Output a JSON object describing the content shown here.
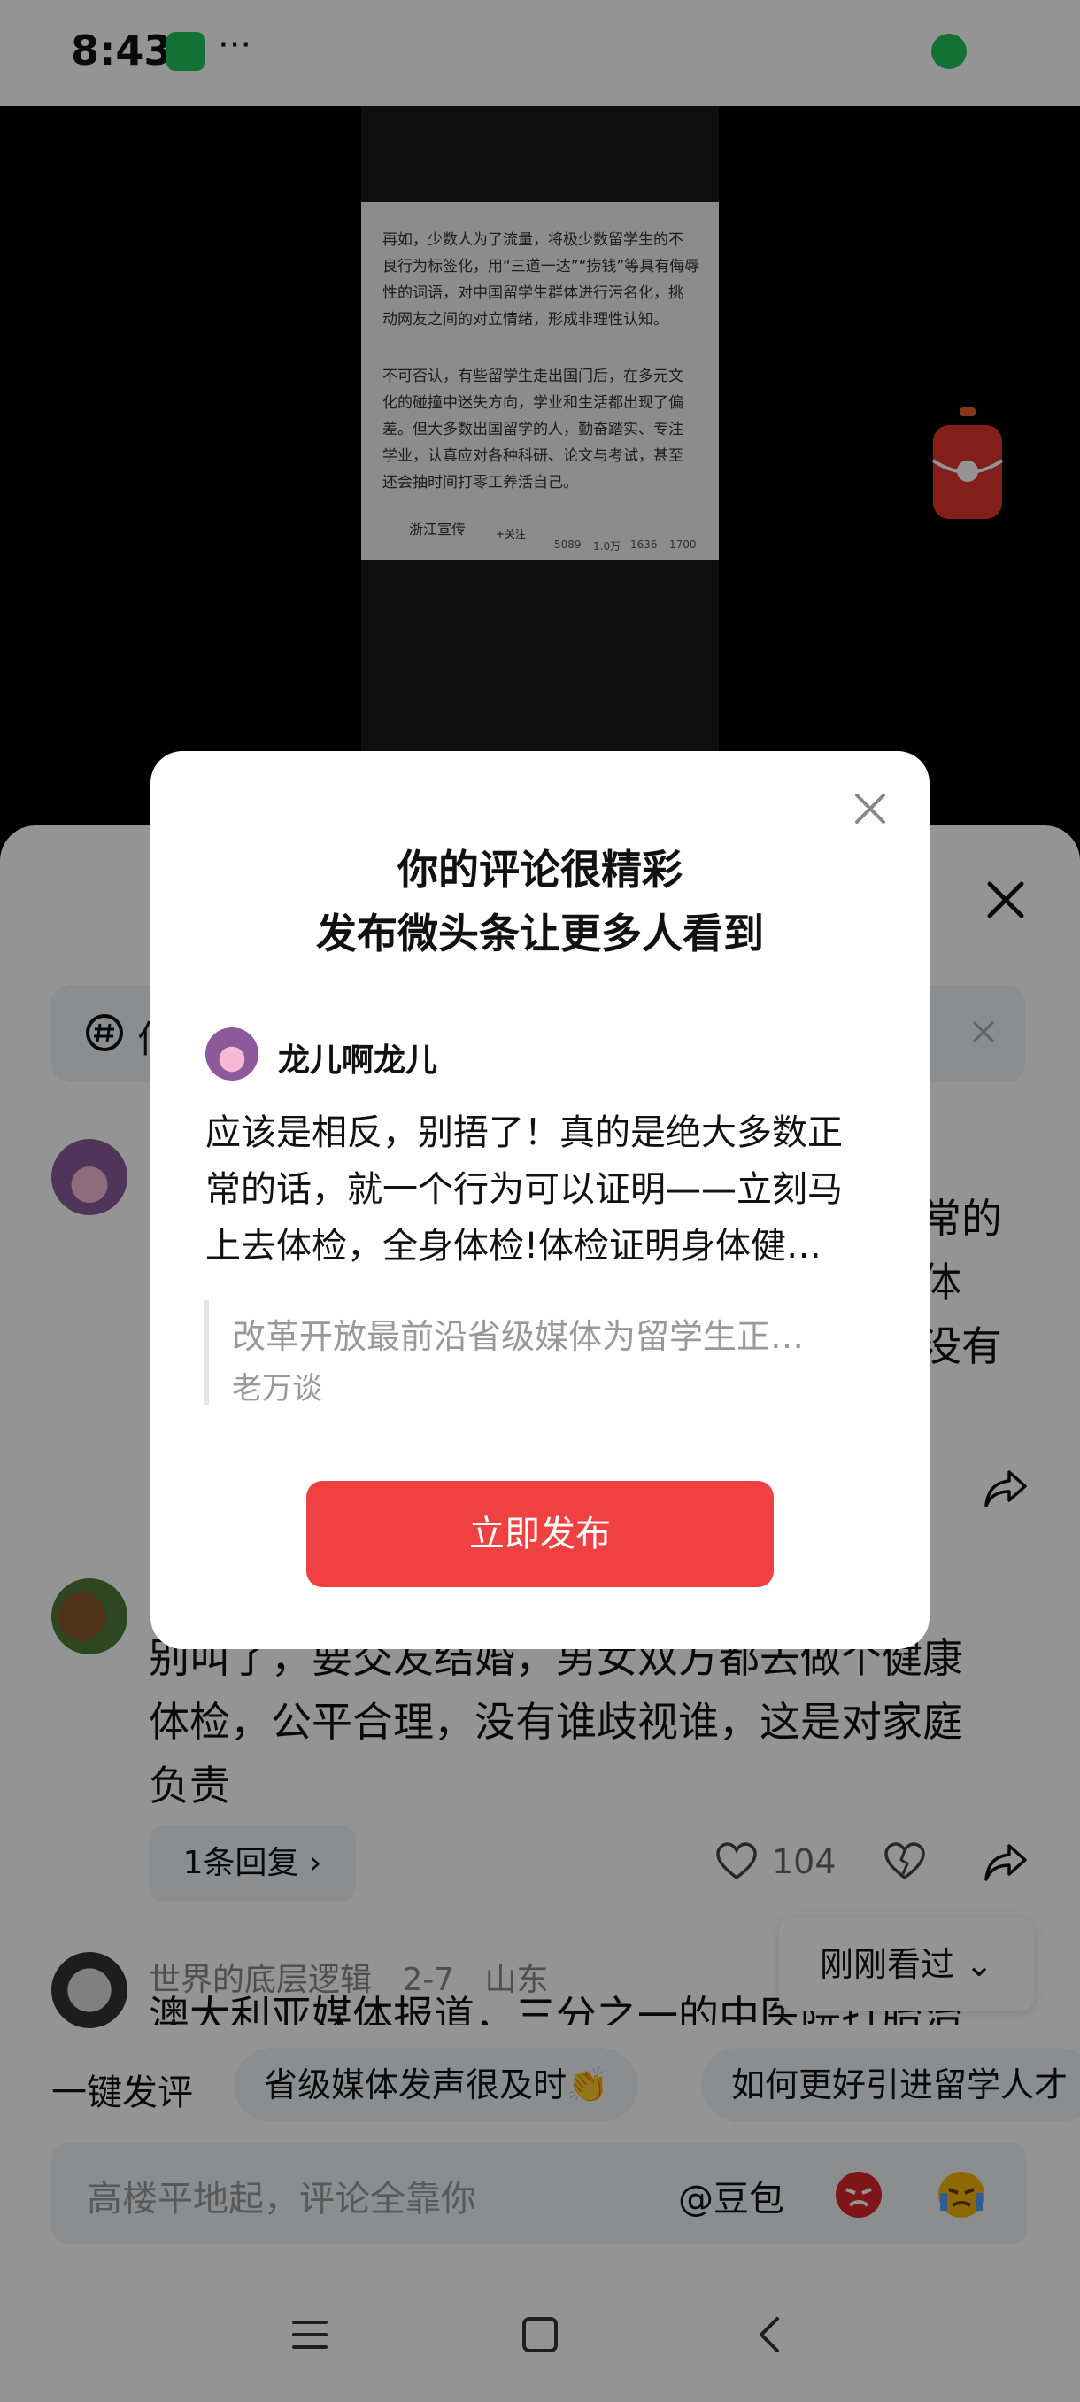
{
  "status_bar": {
    "time": "8:43",
    "more": "···"
  },
  "video": {
    "article_lines": [
      "再如，少数人为了流量，将极少数留学生的不",
      "良行为标签化，用“三道一达”“捞钱”等具有侮辱",
      "性的词语，对中国留学生群体进行污名化，挑",
      "动网友之间的对立情绪，形成非理性认知。",
      "",
      "不可否认，有些留学生走出国门后，在多元文",
      "化的碰撞中迷失方向，学业和生活都出现了偏",
      "差。但大多数出国留学的人，勤奋踏实、专注",
      "学业，认真应对各种科研、论文与考试，甚至",
      "还会抽时间打零工养活自己。"
    ],
    "article_source": "浙江宣传",
    "article_follow": "+关注",
    "article_stats": [
      "5089",
      "1.0万",
      "1636",
      "1700"
    ]
  },
  "topic_bar": {
    "text": "你"
  },
  "comments": [
    {
      "right_fragments": [
        "常的",
        "体",
        "没有"
      ]
    },
    {
      "lines": [
        "别叫了，要交友结婚，男女双方都去做个健康",
        "体检，公平合理，没有谁歧视谁，这是对家庭",
        "负责"
      ],
      "replies": "1条回复 ›",
      "likes": "104"
    },
    {
      "user": "世界的底层逻辑",
      "date": "2-7",
      "location": "山东",
      "text": "澳大利亚媒体报道，三分之一的中医院打胎治"
    }
  ],
  "just_viewed": "刚刚看过 ⌄",
  "quick_comment": {
    "label": "一键发评",
    "chips": [
      "省级媒体发声很及时👏",
      "如何更好引进留学人才"
    ]
  },
  "input": {
    "placeholder": "高楼平地起，评论全靠你",
    "doubao": "@豆包"
  },
  "modal": {
    "title_line1": "你的评论很精彩",
    "title_line2": "发布微头条让更多人看到",
    "username": "龙儿啊龙儿",
    "comment_lines": [
      "应该是相反，别捂了！真的是绝大多数正",
      "常的话，就一个行为可以证明——立刻马",
      "上去体检，全身体检!体检证明身体健…"
    ],
    "quote_title": "改革开放最前沿省级媒体为留学生正…",
    "quote_source": "老万谈",
    "publish_label": "立即发布"
  },
  "colors": {
    "accent": "#f04142",
    "wechat": "#22c35e",
    "overlay": "rgba(0,0,0,0.42)"
  }
}
